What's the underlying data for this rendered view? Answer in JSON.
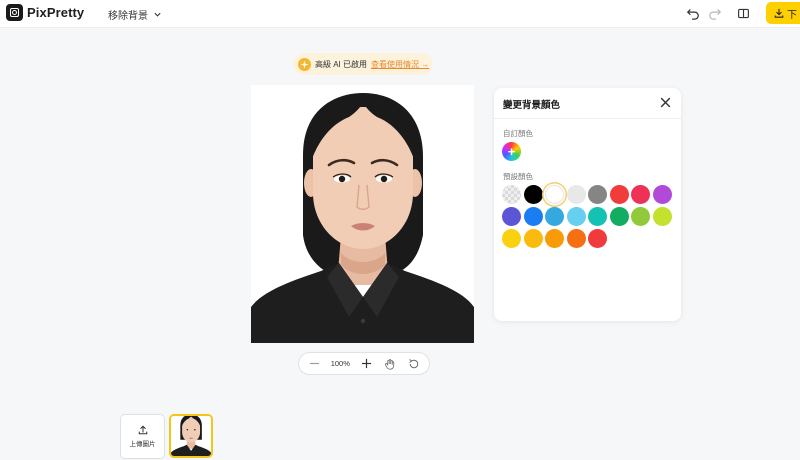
{
  "app": {
    "name": "PixPretty"
  },
  "header": {
    "mode_label": "移除背景",
    "download_label": "下"
  },
  "ai_banner": {
    "text": "高級 AI 已啟用",
    "link": "查看使用情況 →"
  },
  "zoom": {
    "value": "100%"
  },
  "panel": {
    "title": "變更背景顏色",
    "custom_label": "自訂顏色",
    "preset_label": "預設顏色",
    "swatches": [
      {
        "row": 0,
        "col": 0,
        "color": "transparent"
      },
      {
        "row": 0,
        "col": 1,
        "color": "#000000"
      },
      {
        "row": 0,
        "col": 2,
        "color": "#ffffff",
        "selected": true
      },
      {
        "row": 0,
        "col": 3,
        "color": "#e8e8e8"
      },
      {
        "row": 0,
        "col": 4,
        "color": "#858585"
      },
      {
        "row": 0,
        "col": 5,
        "color": "#f23b3b"
      },
      {
        "row": 0,
        "col": 6,
        "color": "#ee3156"
      },
      {
        "row": 0,
        "col": 7,
        "color": "#b14ad9"
      },
      {
        "row": 1,
        "col": 0,
        "color": "#5a56d6"
      },
      {
        "row": 1,
        "col": 1,
        "color": "#1a7ef2"
      },
      {
        "row": 1,
        "col": 2,
        "color": "#36a8e0"
      },
      {
        "row": 1,
        "col": 3,
        "color": "#67cfef"
      },
      {
        "row": 1,
        "col": 4,
        "color": "#13c2b2"
      },
      {
        "row": 1,
        "col": 5,
        "color": "#12ad63"
      },
      {
        "row": 1,
        "col": 6,
        "color": "#92c93a"
      },
      {
        "row": 1,
        "col": 7,
        "color": "#c3e12d"
      },
      {
        "row": 2,
        "col": 0,
        "color": "#fad10f"
      },
      {
        "row": 2,
        "col": 1,
        "color": "#fbbb0e"
      },
      {
        "row": 2,
        "col": 2,
        "color": "#f99a07"
      },
      {
        "row": 2,
        "col": 3,
        "color": "#f66f12"
      },
      {
        "row": 2,
        "col": 4,
        "color": "#ef3b3b"
      }
    ]
  },
  "upload": {
    "label": "上傳圖片"
  },
  "colors": {
    "accent": "#ffd000",
    "banner_bg": "#fdf3dc",
    "link": "#e8882b"
  }
}
